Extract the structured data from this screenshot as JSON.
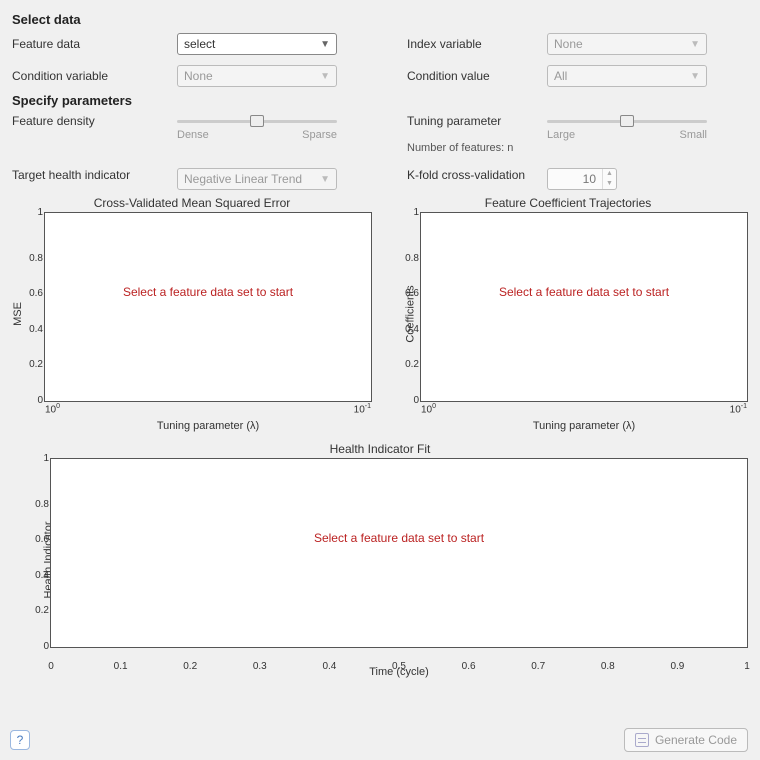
{
  "selectData": {
    "header": "Select data",
    "featureData": {
      "label": "Feature data",
      "value": "select"
    },
    "indexVariable": {
      "label": "Index variable",
      "value": "None"
    },
    "conditionVariable": {
      "label": "Condition variable",
      "value": "None"
    },
    "conditionValue": {
      "label": "Condition value",
      "value": "All"
    }
  },
  "specifyParams": {
    "header": "Specify parameters",
    "featureDensity": {
      "label": "Feature density",
      "left": "Dense",
      "right": "Sparse"
    },
    "tuningParam": {
      "label": "Tuning parameter",
      "left": "Large",
      "right": "Small",
      "subLabel": "Number of features: n"
    },
    "targetHealth": {
      "label": "Target health indicator",
      "value": "Negative Linear Trend"
    },
    "kfold": {
      "label": "K-fold cross-validation",
      "value": "10"
    }
  },
  "charts": {
    "mse": {
      "title": "Cross-Validated Mean Squared Error",
      "ylabel": "MSE",
      "xlabel": "Tuning  parameter  (λ)",
      "placeholder": "Select a feature data set to start"
    },
    "coef": {
      "title": "Feature Coefficient Trajectories",
      "ylabel": "Coefficients",
      "xlabel": "Tuning  parameter  (λ)",
      "placeholder": "Select a feature data set to start"
    },
    "fit": {
      "title": "Health Indicator Fit",
      "ylabel": "Health Indicator",
      "xlabel": "Time (cycle)",
      "placeholder": "Select a feature data set to start"
    }
  },
  "yticks": [
    "0",
    "0.2",
    "0.4",
    "0.6",
    "0.8",
    "1"
  ],
  "xticks_log": {
    "left": "10",
    "leftSup": "0",
    "right": "10",
    "rightSup": "-1"
  },
  "xticks_fit": [
    "0",
    "0.1",
    "0.2",
    "0.3",
    "0.4",
    "0.5",
    "0.6",
    "0.7",
    "0.8",
    "0.9",
    "1"
  ],
  "buttons": {
    "help": "?",
    "generate": "Generate Code"
  },
  "chart_data": [
    {
      "type": "line",
      "title": "Cross-Validated Mean Squared Error",
      "xlabel": "Tuning parameter (λ)",
      "ylabel": "MSE",
      "xscale": "log",
      "xlim": [
        1,
        0.1
      ],
      "ylim": [
        0,
        1
      ],
      "series": []
    },
    {
      "type": "line",
      "title": "Feature Coefficient Trajectories",
      "xlabel": "Tuning parameter (λ)",
      "ylabel": "Coefficients",
      "xscale": "log",
      "xlim": [
        1,
        0.1
      ],
      "ylim": [
        0,
        1
      ],
      "series": []
    },
    {
      "type": "line",
      "title": "Health Indicator Fit",
      "xlabel": "Time (cycle)",
      "ylabel": "Health Indicator",
      "xlim": [
        0,
        1
      ],
      "ylim": [
        0,
        1
      ],
      "series": []
    }
  ]
}
